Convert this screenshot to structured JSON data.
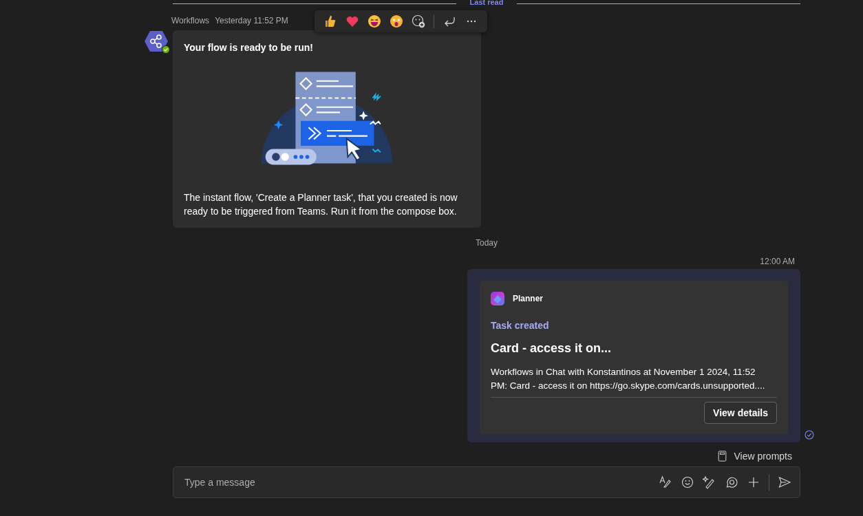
{
  "read_divider": {
    "label": "Last read"
  },
  "bot_message": {
    "sender": "Workflows",
    "time": "Yesterday 11:52 PM",
    "online": true,
    "title": "Your flow is ready to be run!",
    "body": "The instant flow, 'Create a Planner task', that you created is now ready to be triggered from Teams. Run it from the compose box."
  },
  "reaction_bar": [
    {
      "kind": "like"
    },
    {
      "kind": "heart"
    },
    {
      "kind": "laugh"
    },
    {
      "kind": "surprised"
    },
    {
      "kind": "add-reaction"
    },
    {
      "kind": "divider"
    },
    {
      "kind": "reply"
    },
    {
      "kind": "more"
    }
  ],
  "day_divider": {
    "label": "Today"
  },
  "sent_message": {
    "time": "12:00 AM",
    "read": true,
    "app": "Planner",
    "event": "Task created",
    "title": "Card - access it on...",
    "body": "Workflows in Chat with Konstantinos at November 1 2024, 11:52 PM: Card - access it on https://go.skype.com/cards.unsupported....",
    "button": "View details"
  },
  "prompts_link": {
    "label": "View prompts"
  },
  "compose": {
    "placeholder": "Type a message",
    "tools": [
      {
        "kind": "format"
      },
      {
        "kind": "emoji"
      },
      {
        "kind": "copilot"
      },
      {
        "kind": "loop"
      },
      {
        "kind": "attach"
      },
      {
        "kind": "divider"
      },
      {
        "kind": "send"
      }
    ]
  }
}
